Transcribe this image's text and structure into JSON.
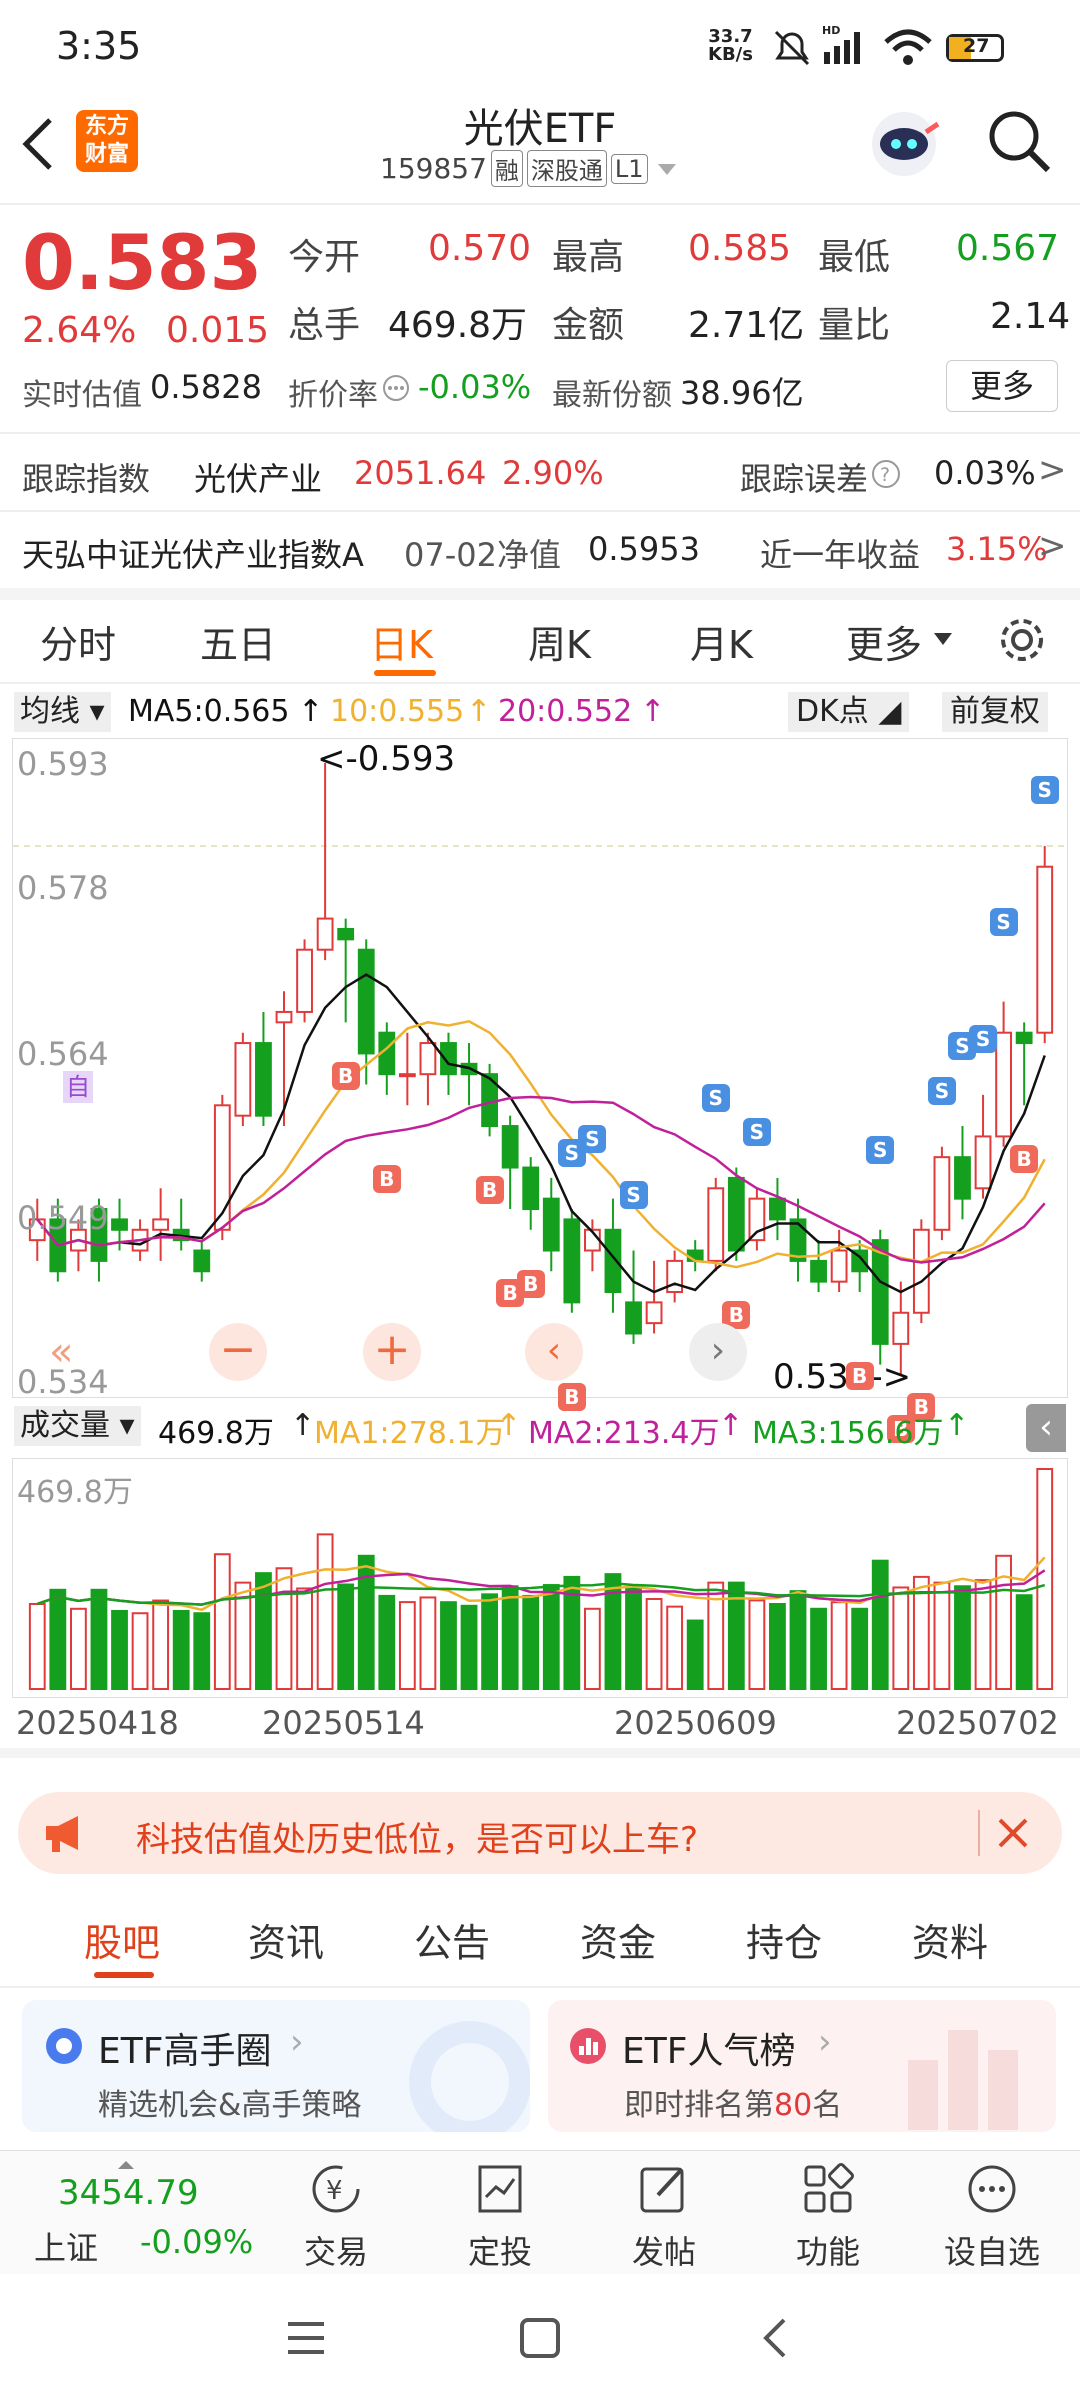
{
  "status_bar": {
    "time": "3:35",
    "speed_top": "33.7",
    "speed_unit": "KB/s",
    "battery": "27"
  },
  "header": {
    "logo_line1": "东方",
    "logo_line2": "财富",
    "title": "光伏ETF",
    "code": "159857",
    "tag1": "融",
    "tag2": "深股通",
    "tag3": "L1"
  },
  "quote": {
    "price": "0.583",
    "change_pct": "2.64%",
    "change": "0.015",
    "open_label": "今开",
    "open": "0.570",
    "high_label": "最高",
    "high": "0.585",
    "low_label": "最低",
    "low": "0.567",
    "vol_label": "总手",
    "vol": "469.8万",
    "amt_label": "金额",
    "amt": "2.71亿",
    "ratio_label": "量比",
    "ratio": "2.14",
    "est_label": "实时估值",
    "est": "0.5828",
    "disc_label": "折价率",
    "disc": "-0.03%",
    "share_label": "最新份额",
    "share": "38.96亿",
    "more": "更多"
  },
  "track": {
    "label": "跟踪指数",
    "index": "光伏产业",
    "value": "2051.64",
    "pct": "2.90%",
    "err_label": "跟踪误差",
    "err": "0.03%"
  },
  "fund": {
    "name": "天弘中证光伏产业指数A",
    "nav_label": "07-02净值",
    "nav": "0.5953",
    "ret_label": "近一年收益",
    "ret": "3.15%"
  },
  "tabs": [
    "分时",
    "五日",
    "日K",
    "周K",
    "月K",
    "更多"
  ],
  "active_tab": "日K",
  "ma_bar": {
    "select": "均线",
    "ma5": "MA5:0.565",
    "ma10": "10:0.555",
    "ma20": "20:0.552",
    "dk": "DK点",
    "adj": "前复权"
  },
  "price_axis": [
    "0.593",
    "0.578",
    "0.564",
    "0.549",
    "0.534"
  ],
  "annotations": {
    "high": "<-0.593",
    "low": "0.534->",
    "auto": "自"
  },
  "vol_bar": {
    "select": "成交量",
    "vol": "469.8万",
    "ma1": "MA1:278.1万",
    "ma2": "MA2:213.4万",
    "ma3": "MA3:156.6万"
  },
  "vol_axis_top": "469.8万",
  "dates": [
    "20250418",
    "20250514",
    "20250609",
    "20250702"
  ],
  "banner": {
    "text": "科技估值处历史低位，是否可以上车?"
  },
  "sub_tabs": [
    "股吧",
    "资讯",
    "公告",
    "资金",
    "持仓",
    "资料"
  ],
  "cards": [
    {
      "title": "ETF高手圈",
      "desc": "精选机会&高手策略"
    },
    {
      "title": "ETF人气榜",
      "desc_pre": "即时排名第",
      "rank": "80",
      "desc_post": "名"
    }
  ],
  "bottom": {
    "index_value": "3454.79",
    "index_name": "上证",
    "index_pct": "-0.09%",
    "items": [
      "交易",
      "定投",
      "发帖",
      "功能",
      "设自选"
    ]
  },
  "colors": {
    "up": "#e03a3a",
    "down": "#14a01e",
    "accent": "#ff6a00",
    "ma5": "#111111",
    "ma10": "#f0b030",
    "ma20": "#c0209a"
  },
  "chart_data": {
    "type": "candlestick",
    "title": "",
    "ylim": [
      0.534,
      0.593
    ],
    "candles": [
      [
        0.547,
        0.549,
        0.545,
        0.551
      ],
      [
        0.549,
        0.544,
        0.543,
        0.551
      ],
      [
        0.546,
        0.548,
        0.544,
        0.549
      ],
      [
        0.55,
        0.545,
        0.543,
        0.551
      ],
      [
        0.549,
        0.548,
        0.546,
        0.551
      ],
      [
        0.546,
        0.548,
        0.545,
        0.549
      ],
      [
        0.548,
        0.549,
        0.545,
        0.552
      ],
      [
        0.548,
        0.547,
        0.546,
        0.551
      ],
      [
        0.546,
        0.544,
        0.543,
        0.547
      ],
      [
        0.548,
        0.56,
        0.547,
        0.561
      ],
      [
        0.559,
        0.566,
        0.558,
        0.567
      ],
      [
        0.566,
        0.559,
        0.558,
        0.569
      ],
      [
        0.568,
        0.569,
        0.558,
        0.571
      ],
      [
        0.569,
        0.575,
        0.568,
        0.576
      ],
      [
        0.575,
        0.578,
        0.574,
        0.593
      ],
      [
        0.577,
        0.576,
        0.568,
        0.578
      ],
      [
        0.575,
        0.565,
        0.562,
        0.576
      ],
      [
        0.567,
        0.563,
        0.561,
        0.568
      ],
      [
        0.563,
        0.563,
        0.56,
        0.567
      ],
      [
        0.563,
        0.566,
        0.56,
        0.567
      ],
      [
        0.566,
        0.563,
        0.561,
        0.567
      ],
      [
        0.564,
        0.563,
        0.56,
        0.566
      ],
      [
        0.563,
        0.558,
        0.557,
        0.564
      ],
      [
        0.558,
        0.554,
        0.55,
        0.559
      ],
      [
        0.554,
        0.55,
        0.548,
        0.555
      ],
      [
        0.551,
        0.546,
        0.544,
        0.553
      ],
      [
        0.549,
        0.541,
        0.54,
        0.55
      ],
      [
        0.546,
        0.548,
        0.544,
        0.549
      ],
      [
        0.548,
        0.542,
        0.54,
        0.551
      ],
      [
        0.541,
        0.538,
        0.537,
        0.546
      ],
      [
        0.539,
        0.541,
        0.538,
        0.545
      ],
      [
        0.542,
        0.545,
        0.541,
        0.546
      ],
      [
        0.546,
        0.545,
        0.544,
        0.547
      ],
      [
        0.545,
        0.552,
        0.544,
        0.553
      ],
      [
        0.553,
        0.546,
        0.545,
        0.554
      ],
      [
        0.547,
        0.551,
        0.546,
        0.552
      ],
      [
        0.551,
        0.549,
        0.547,
        0.553
      ],
      [
        0.549,
        0.545,
        0.543,
        0.551
      ],
      [
        0.545,
        0.543,
        0.542,
        0.547
      ],
      [
        0.543,
        0.546,
        0.542,
        0.548
      ],
      [
        0.546,
        0.544,
        0.542,
        0.547
      ],
      [
        0.547,
        0.537,
        0.535,
        0.548
      ],
      [
        0.537,
        0.54,
        0.534,
        0.543
      ],
      [
        0.54,
        0.548,
        0.539,
        0.549
      ],
      [
        0.548,
        0.555,
        0.547,
        0.556
      ],
      [
        0.555,
        0.551,
        0.549,
        0.558
      ],
      [
        0.552,
        0.557,
        0.551,
        0.561
      ],
      [
        0.557,
        0.567,
        0.556,
        0.57
      ],
      [
        0.567,
        0.566,
        0.56,
        0.568
      ],
      [
        0.567,
        0.583,
        0.566,
        0.585
      ]
    ],
    "volume_max_label": "469.8万"
  }
}
